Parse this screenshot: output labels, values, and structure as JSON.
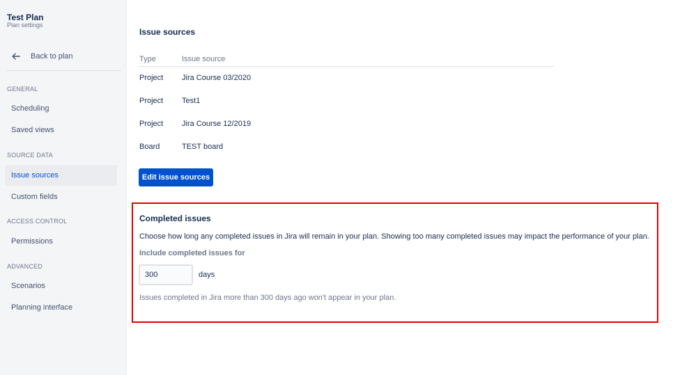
{
  "sidebar": {
    "plan_title": "Test Plan",
    "plan_subtitle": "Plan settings",
    "back_label": "Back to plan",
    "sections": [
      {
        "heading": "GENERAL",
        "items": [
          "Scheduling",
          "Saved views"
        ]
      },
      {
        "heading": "SOURCE DATA",
        "items": [
          "Issue sources",
          "Custom fields"
        ]
      },
      {
        "heading": "ACCESS CONTROL",
        "items": [
          "Permissions"
        ]
      },
      {
        "heading": "ADVANCED",
        "items": [
          "Scenarios",
          "Planning interface"
        ]
      }
    ],
    "active_item": "Issue sources"
  },
  "issue_sources": {
    "title": "Issue sources",
    "columns": [
      "Type",
      "Issue source"
    ],
    "rows": [
      {
        "type": "Project",
        "source": "Jira Course 03/2020"
      },
      {
        "type": "Project",
        "source": "Test1"
      },
      {
        "type": "Project",
        "source": "Jira Course 12/2019"
      },
      {
        "type": "Board",
        "source": "TEST board"
      }
    ],
    "edit_button_label": "Edit issue sources"
  },
  "completed_issues": {
    "title": "Completed issues",
    "description": "Choose how long any completed issues in Jira will remain in your plan. Showing too many completed issues may impact the performance of your plan.",
    "field_label": "Include completed issues for",
    "days_value": "300",
    "days_unit": "days",
    "help_text": "Issues completed in Jira more than 300 days ago won't appear in your plan."
  },
  "colors": {
    "primary": "#0052cc",
    "highlight_border": "#e10000",
    "sidebar_bg": "#f4f5f7"
  },
  "icons": {
    "back": "arrow-left-icon"
  }
}
